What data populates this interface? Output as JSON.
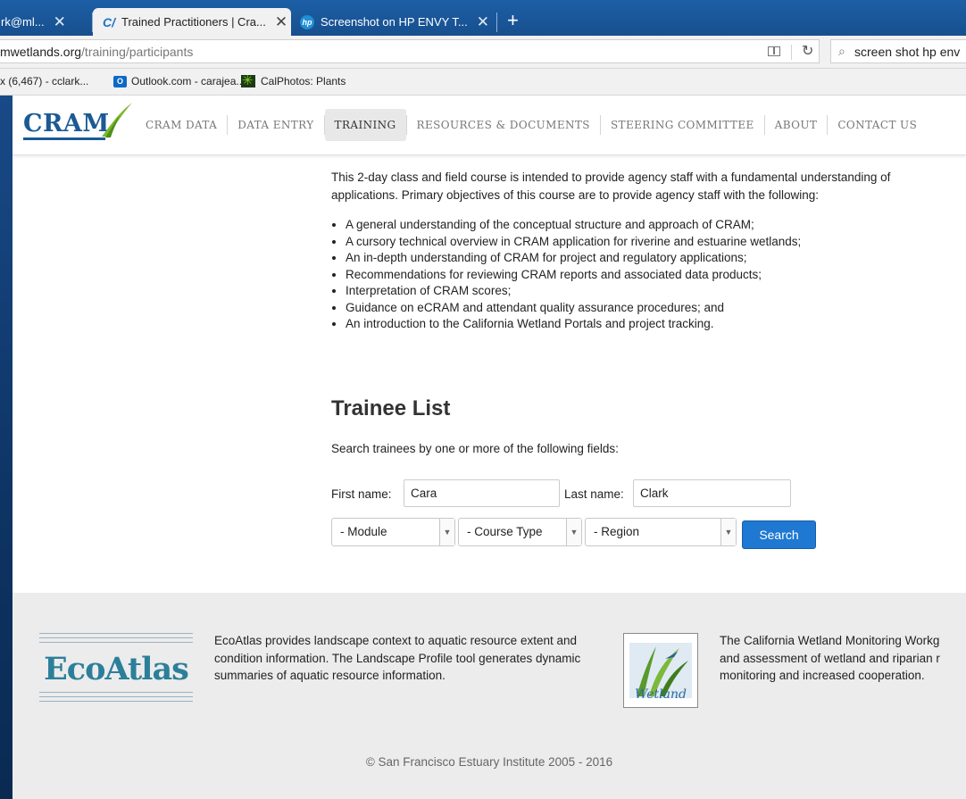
{
  "browser": {
    "tabs": [
      {
        "label": "rk@ml..."
      },
      {
        "label": "Trained Practitioners | Cra..."
      },
      {
        "label": "Screenshot on HP ENVY T..."
      }
    ],
    "url_domain": "mwetlands.org",
    "url_path": "/training/participants",
    "search_value": "screen shot hp env",
    "bookmarks": [
      {
        "label": "x (6,467) - cclark..."
      },
      {
        "label": "Outlook.com - carajea..."
      },
      {
        "label": "CalPhotos: Plants"
      }
    ]
  },
  "site": {
    "logo": "CRAM",
    "nav": [
      "CRAM DATA",
      "DATA ENTRY",
      "TRAINING",
      "RESOURCES & DOCUMENTS",
      "STEERING COMMITTEE",
      "ABOUT",
      "CONTACT US"
    ]
  },
  "course": {
    "intro_line1": "This 2-day class and field course is intended to provide agency staff with a fundamental understanding of",
    "intro_line2": "applications. Primary objectives of this course are to provide agency staff with the following:",
    "objectives": [
      "A general understanding of the conceptual structure and approach of CRAM;",
      "A cursory technical overview in CRAM application for riverine and estuarine wetlands;",
      "An in-depth understanding of CRAM for project and regulatory applications;",
      "Recommendations for reviewing CRAM reports and associated data products;",
      "Interpretation of CRAM scores;",
      "Guidance on eCRAM and attendant quality assurance procedures; and",
      "An introduction to the California Wetland Portals and project tracking."
    ]
  },
  "trainees": {
    "title": "Trainee List",
    "help": "Search trainees by one or more of the following fields:",
    "first_name_label": "First name:",
    "first_name_value": "Cara",
    "last_name_label": "Last name:",
    "last_name_value": "Clark",
    "module": "- Module",
    "course_type": "- Course Type",
    "region": "- Region",
    "search_button": "Search"
  },
  "footer": {
    "ecoatlas_logo": "EcoAtlas",
    "ecoatlas_text": "EcoAtlas provides landscape context to aquatic resource extent and condition information. The Landscape Profile tool generates dynamic summaries of aquatic resource information.",
    "wetland_logo_caption": "Wetland",
    "wetland_lines": [
      "The California Wetland Monitoring Workg",
      "and assessment of wetland and riparian r",
      "monitoring and increased cooperation."
    ],
    "copyright": "© San Francisco Estuary Institute 2005 - 2016"
  }
}
